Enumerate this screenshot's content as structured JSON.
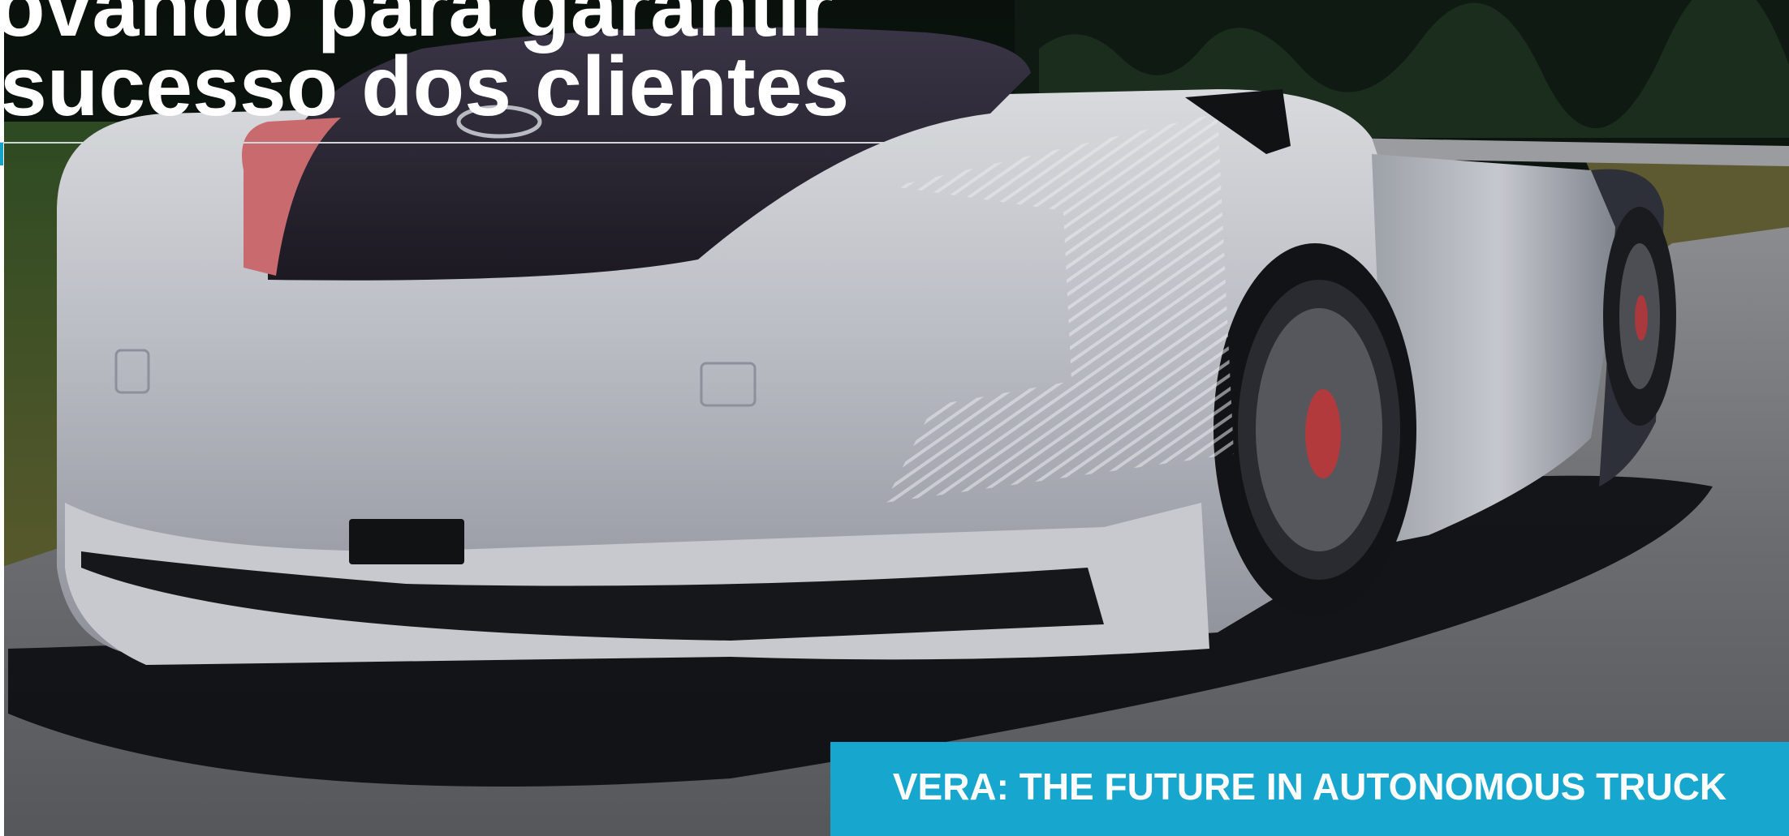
{
  "slide": {
    "title_line1": "ovando para garantir",
    "title_line2": "sucesso dos clientes",
    "banner_text": "VERA: THE FUTURE IN AUTONOMOUS TRUCK"
  },
  "colors": {
    "accent": "#17a6cd",
    "title_text": "#ffffff",
    "vehicle_body": "#c9cbd0",
    "vehicle_stripe": "#c8646a",
    "road": "#6d6f72"
  },
  "image": {
    "subject": "autonomous-truck-photo"
  }
}
